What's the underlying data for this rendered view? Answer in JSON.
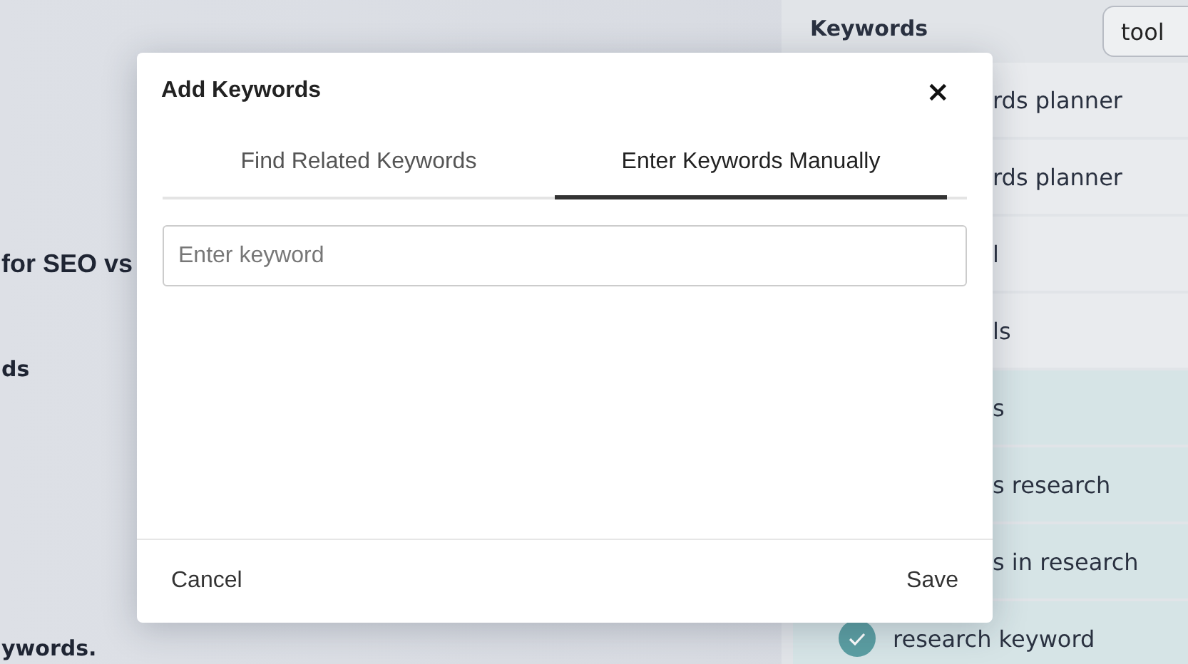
{
  "background": {
    "left_texts": [
      "for SEO vs",
      "ds",
      "ywords."
    ],
    "keywords_panel": {
      "title": "Keywords",
      "search": {
        "value": "tool"
      },
      "rows": [
        {
          "text": "rds planner",
          "kind": "partial",
          "selected": false
        },
        {
          "text": "rds planner",
          "kind": "partial",
          "selected": false
        },
        {
          "text": "l",
          "kind": "partial",
          "selected": false
        },
        {
          "text": "ls",
          "kind": "partial",
          "selected": false
        },
        {
          "text": "s",
          "kind": "partial",
          "selected": true
        },
        {
          "text": "s research",
          "kind": "partial",
          "selected": true
        },
        {
          "text": "s in research",
          "kind": "partial",
          "selected": true
        },
        {
          "text": "research keyword",
          "kind": "full",
          "selected": true
        }
      ]
    }
  },
  "dialog": {
    "title": "Add Keywords",
    "close": "×",
    "tabs": [
      {
        "label": "Find Related Keywords",
        "selected": false
      },
      {
        "label": "Enter Keywords Manually",
        "selected": true
      }
    ],
    "input": {
      "placeholder": "Enter keyword"
    },
    "buttons": [
      "Cancel",
      "Save"
    ]
  }
}
